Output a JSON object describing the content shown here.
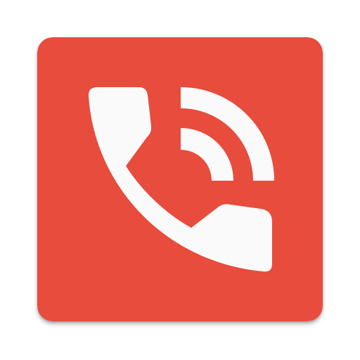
{
  "icon": {
    "name": "phone-call-icon",
    "background_color": "#E74C3C",
    "glyph_color": "#FAFAFA",
    "glyph_parts": [
      "phone-handset",
      "signal-arc-inner",
      "signal-arc-outer"
    ]
  }
}
